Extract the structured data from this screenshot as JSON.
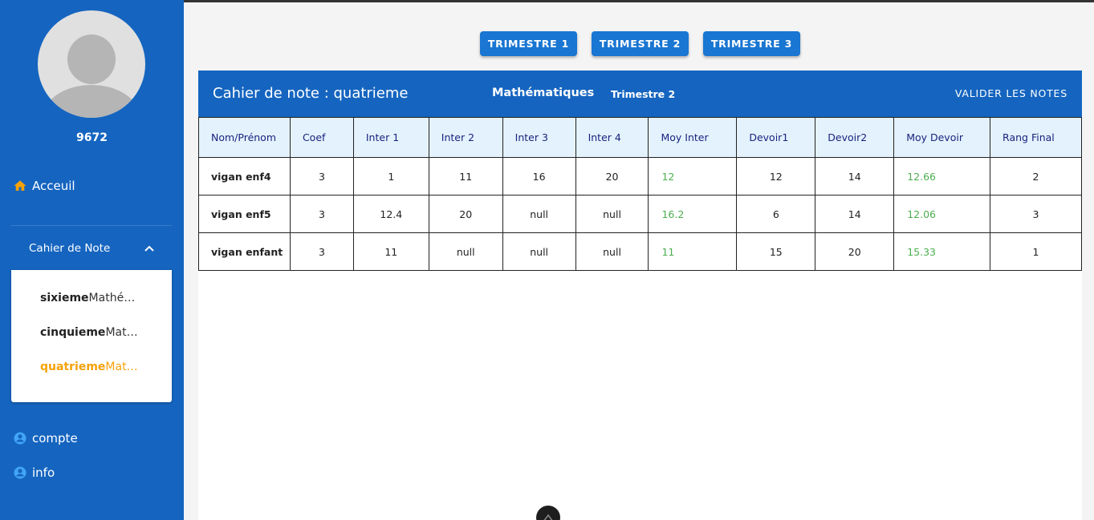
{
  "sidebar": {
    "username": "9672",
    "nav": {
      "accueil": "Acceuil",
      "group": "Cahier de Note",
      "compte": "compte",
      "info": "info"
    },
    "classes": [
      {
        "name": "sixieme",
        "subject": "Mathématiques"
      },
      {
        "name": "cinquieme",
        "subject": "Mathématiques"
      },
      {
        "name": "quatrieme",
        "subject": "Mathématiques"
      }
    ]
  },
  "toolbar": {
    "tri1": "TRIMESTRE 1",
    "tri2": "TRIMESTRE 2",
    "tri3": "TRIMESTRE 3"
  },
  "header": {
    "title": "Cahier de note : quatrieme",
    "subject": "Mathématiques",
    "trimester": "Trimestre 2",
    "validate": "VALIDER LES NOTES"
  },
  "table": {
    "columns": [
      "Nom/Prénom",
      "Coef",
      "Inter 1",
      "Inter 2",
      "Inter 3",
      "Inter 4",
      "Moy Inter",
      "Devoir1",
      "Devoir2",
      "Moy Devoir",
      "Rang Final"
    ],
    "rows": [
      [
        "vigan enf4",
        "3",
        "1",
        "11",
        "16",
        "20",
        "12",
        "12",
        "14",
        "12.66",
        "2"
      ],
      [
        "vigan enf5",
        "3",
        "12.4",
        "20",
        "null",
        "null",
        "16.2",
        "6",
        "14",
        "12.06",
        "3"
      ],
      [
        "vigan enfant",
        "3",
        "11",
        "null",
        "null",
        "null",
        "11",
        "15",
        "20",
        "15.33",
        "1"
      ]
    ]
  },
  "colors": {
    "sidebar": "#1565c0",
    "accent": "#1976d2",
    "active": "#f5a20a",
    "average": "#4caf50",
    "header_cell_bg": "#e3f2fd",
    "home_icon": "#f5a20a",
    "user_icon": "#42a5f5"
  }
}
